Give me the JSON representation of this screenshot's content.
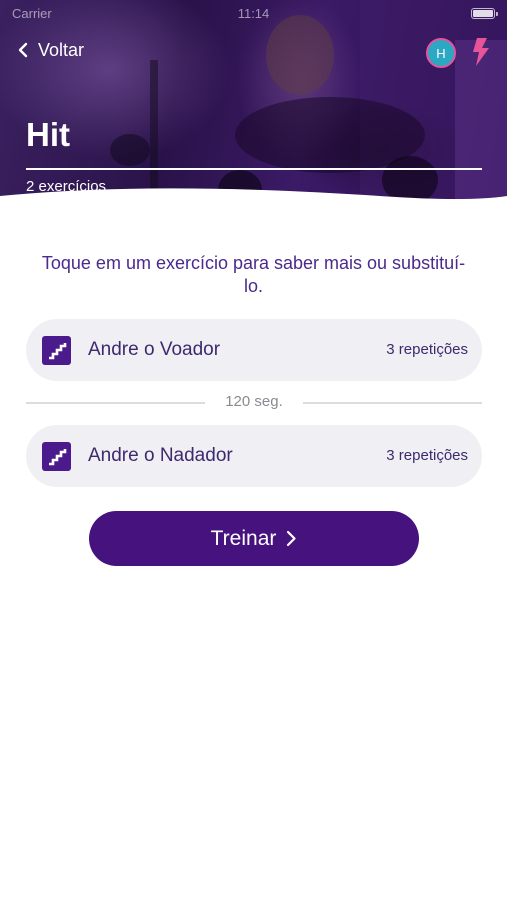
{
  "status_bar": {
    "carrier": "Carrier",
    "time": "11:14"
  },
  "header": {
    "back_label": "Voltar",
    "avatar_initial": "H",
    "title": "Hit",
    "subtitle": "2 exercícios"
  },
  "instruction": "Toque em um exercício para saber mais ou substituí-lo.",
  "exercises": [
    {
      "name": "Andre o Voador",
      "reps": "3 repetições",
      "icon": "stairs-icon"
    },
    {
      "name": "Andre o Nadador",
      "reps": "3 repetições",
      "icon": "stairs-icon"
    }
  ],
  "rest": {
    "label": "120 seg."
  },
  "train_button": {
    "label": "Treinar"
  },
  "colors": {
    "primary": "#46137e",
    "accent_pink": "#e8549a",
    "avatar_bg": "#2aa8c4",
    "card_bg": "#f0eff3",
    "text_purple": "#4a2a8c"
  }
}
